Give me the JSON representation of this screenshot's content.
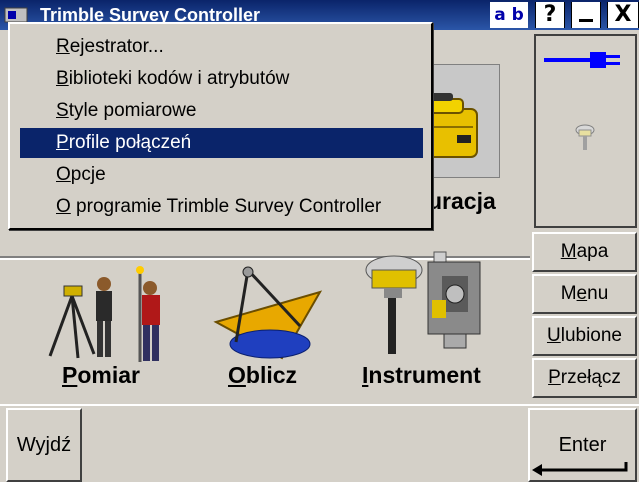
{
  "window": {
    "title": "Trimble Survey Controller",
    "input_mode": "a b",
    "help_label": "?",
    "minimize_label": "—",
    "close_label": "X"
  },
  "menu": {
    "selected_index": 3,
    "items": [
      {
        "mnemonic": "R",
        "rest": "ejestrator..."
      },
      {
        "mnemonic": "B",
        "rest": "iblioteki kodów i atrybutów"
      },
      {
        "mnemonic": "S",
        "rest": "tyle pomiarowe"
      },
      {
        "mnemonic": "P",
        "rest": "rofile połączeń"
      },
      {
        "mnemonic": "O",
        "rest": "pcje"
      },
      {
        "mnemonic": "O",
        "rest": " programie Trimble Survey Controller"
      }
    ]
  },
  "main_icons": {
    "config_label_partial": "uracja",
    "measure": {
      "mnemonic": "P",
      "rest": "omiar"
    },
    "compute": {
      "mnemonic": "O",
      "rest": "blicz"
    },
    "instrument": {
      "mnemonic": "I",
      "rest": "nstrument"
    }
  },
  "side_buttons": {
    "map": {
      "pre": "",
      "mnemonic": "M",
      "post": "apa"
    },
    "menu": {
      "pre": "M",
      "mnemonic": "e",
      "post": "nu"
    },
    "favorites": {
      "pre": "",
      "mnemonic": "U",
      "post": "lubione"
    },
    "switch": {
      "pre": "",
      "mnemonic": "P",
      "post": "rzełącz"
    }
  },
  "bottom": {
    "exit_label": "Wyjdź",
    "enter_label": "Enter"
  },
  "colors": {
    "background": "#d4d0c8",
    "titlebar": "#0a246a",
    "selection": "#0a246a",
    "power_icon": "#0000ff"
  }
}
